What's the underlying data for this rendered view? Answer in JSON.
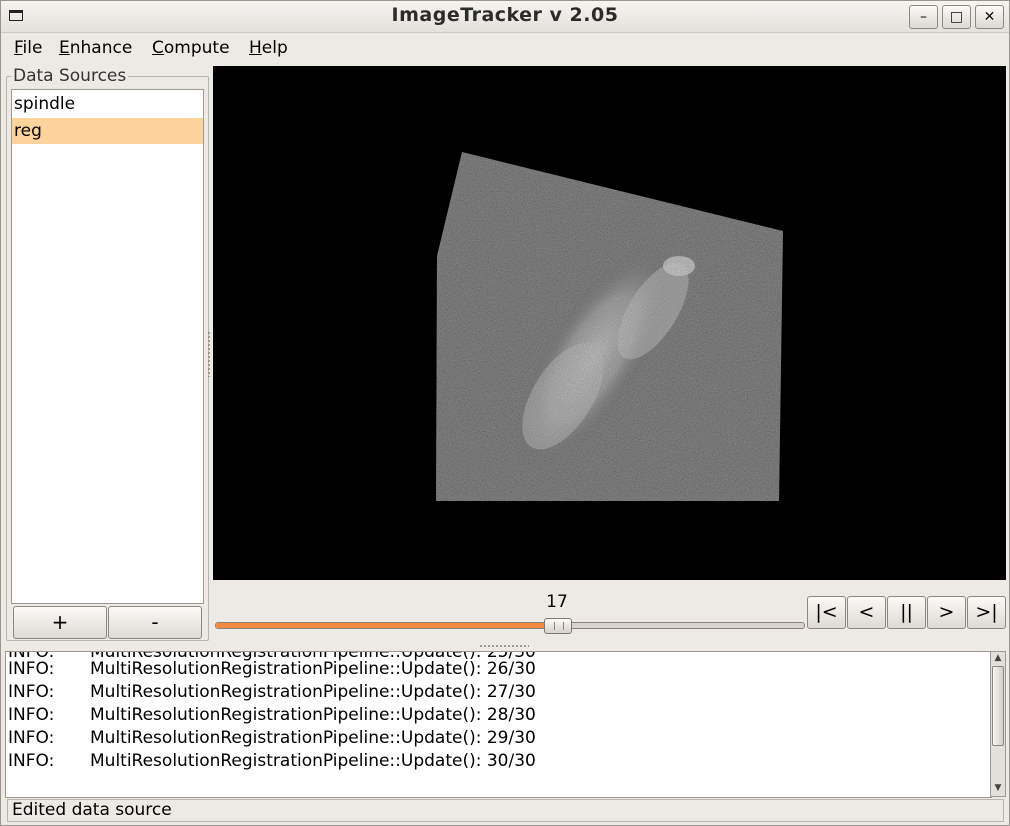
{
  "window": {
    "title": "ImageTracker v 2.05",
    "minimize_label": "–",
    "maximize_label": "□",
    "close_label": "✕"
  },
  "menu": [
    {
      "label": "File",
      "mnemonic": "F",
      "rest": "ile"
    },
    {
      "label": "Enhance",
      "mnemonic": "E",
      "rest": "nhance"
    },
    {
      "label": "Compute",
      "mnemonic": "C",
      "rest": "ompute"
    },
    {
      "label": "Help",
      "mnemonic": "H",
      "rest": "elp"
    }
  ],
  "data_sources": {
    "legend": "Data Sources",
    "items": [
      {
        "label": "spindle",
        "selected": false
      },
      {
        "label": "reg",
        "selected": true
      }
    ],
    "add_label": "+",
    "remove_label": "-"
  },
  "player": {
    "frame": "17",
    "position_fraction": 0.58,
    "first_label": "|<",
    "prev_label": "<",
    "pause_label": "||",
    "next_label": ">",
    "last_label": ">|"
  },
  "log": {
    "lines": [
      {
        "level": "INFO:",
        "message": "MultiResolutionRegistrationPipeline::Update(): 26/30"
      },
      {
        "level": "INFO:",
        "message": "MultiResolutionRegistrationPipeline::Update(): 27/30"
      },
      {
        "level": "INFO:",
        "message": "MultiResolutionRegistrationPipeline::Update(): 28/30"
      },
      {
        "level": "INFO:",
        "message": "MultiResolutionRegistrationPipeline::Update(): 29/30"
      },
      {
        "level": "INFO:",
        "message": "MultiResolutionRegistrationPipeline::Update(): 30/30"
      }
    ]
  },
  "status": "Edited data source",
  "colors": {
    "selection": "#fdd39d",
    "slider_fill": "#f2893e",
    "viewer_bg": "#000000"
  }
}
